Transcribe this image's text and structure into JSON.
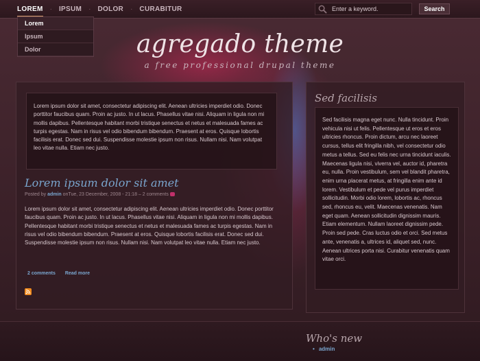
{
  "nav": {
    "items": [
      {
        "label": "LOREM"
      },
      {
        "label": "IPSUM"
      },
      {
        "label": "DOLOR"
      },
      {
        "label": "CURABITUR"
      }
    ],
    "separator": "·"
  },
  "dropdown": {
    "items": [
      {
        "label": "Lorem"
      },
      {
        "label": "Ipsum"
      },
      {
        "label": "Dolor"
      }
    ]
  },
  "search": {
    "placeholder": "Enter a keyword.",
    "button_label": "Search"
  },
  "header": {
    "title": "agregado theme",
    "slogan": "a free professional drupal theme"
  },
  "intro": {
    "text": "Lorem ipsum dolor sit amet, consectetur adipiscing elit. Aenean ultricies imperdiet odio. Donec porttitor faucibus quam. Proin ac justo. In ut lacus. Phasellus vitae nisi. Aliquam in ligula non mi mollis dapibus. Pellentesque habitant morbi tristique senectus et netus et malesuada fames ac turpis egestas. Nam in risus vel odio bibendum bibendum. Praesent at eros. Quisque lobortis facilisis erat. Donec sed dui. Suspendisse molestie ipsum non risus. Nullam nisi. Nam volutpat leo vitae nulla. Etiam nec justo."
  },
  "post": {
    "title": "Lorem ipsum dolor sit amet",
    "meta_prefix": "Posted by ",
    "author": "admin",
    "meta_suffix": " onTue, 23 December, 2008 - 21:18 – 2 comments",
    "body": "Lorem ipsum dolor sit amet, consectetur adipiscing elit. Aenean ultricies imperdiet odio. Donec porttitor faucibus quam. Proin ac justo. In ut lacus. Phasellus vitae nisi. Aliquam in ligula non mi mollis dapibus. Pellentesque habitant morbi tristique senectus et netus et malesuada fames ac turpis egestas. Nam in risus vel odio bibendum bibendum. Praesent at eros. Quisque lobortis facilisis erat. Donec sed dui. Suspendisse molestie ipsum non risus. Nullam nisi. Nam volutpat leo vitae nulla. Etiam nec justo.",
    "comments_link": "2 comments",
    "read_more_link": "Read more"
  },
  "sidebar": {
    "title": "Sed facilisis",
    "text": "Sed facilisis magna eget nunc. Nulla tincidunt. Proin vehicula nisi ut felis. Pellentesque ut eros et eros ultricies rhoncus. Proin dictum, arcu nec laoreet cursus, tellus elit fringilla nibh, vel consectetur odio metus a tellus. Sed eu felis nec urna tincidunt iaculis. Maecenas ligula nisi, viverra vel, auctor id, pharetra eu, nulla. Proin vestibulum, sem vel blandit pharetra, enim urna placerat metus, at fringilla enim ante id lorem. Vestibulum et pede vel purus imperdiet sollicitudin. Morbi odio lorem, lobortis ac, rhoncus sed, rhoncus eu, velit. Maecenas venenatis. Nam eget quam. Aenean sollicitudin dignissim mauris. Etiam elementum. Nullam laoreet dignissim pede. Proin sed pede. Cras luctus odio et orci. Sed metus ante, venenatis a, ultrices id, aliquet sed, nunc. Aenean ultrices porta nisi. Curabitur venenatis quam vitae orci."
  },
  "whos_new": {
    "title": "Who's new",
    "users": [
      {
        "name": "admin"
      }
    ]
  },
  "icons": {
    "search": "search-icon",
    "rss": "rss-icon",
    "comment": "comment-icon"
  },
  "colors": {
    "accent_link": "#7aa6cf",
    "rss": "#f08a1e",
    "comment": "#c0306a"
  }
}
